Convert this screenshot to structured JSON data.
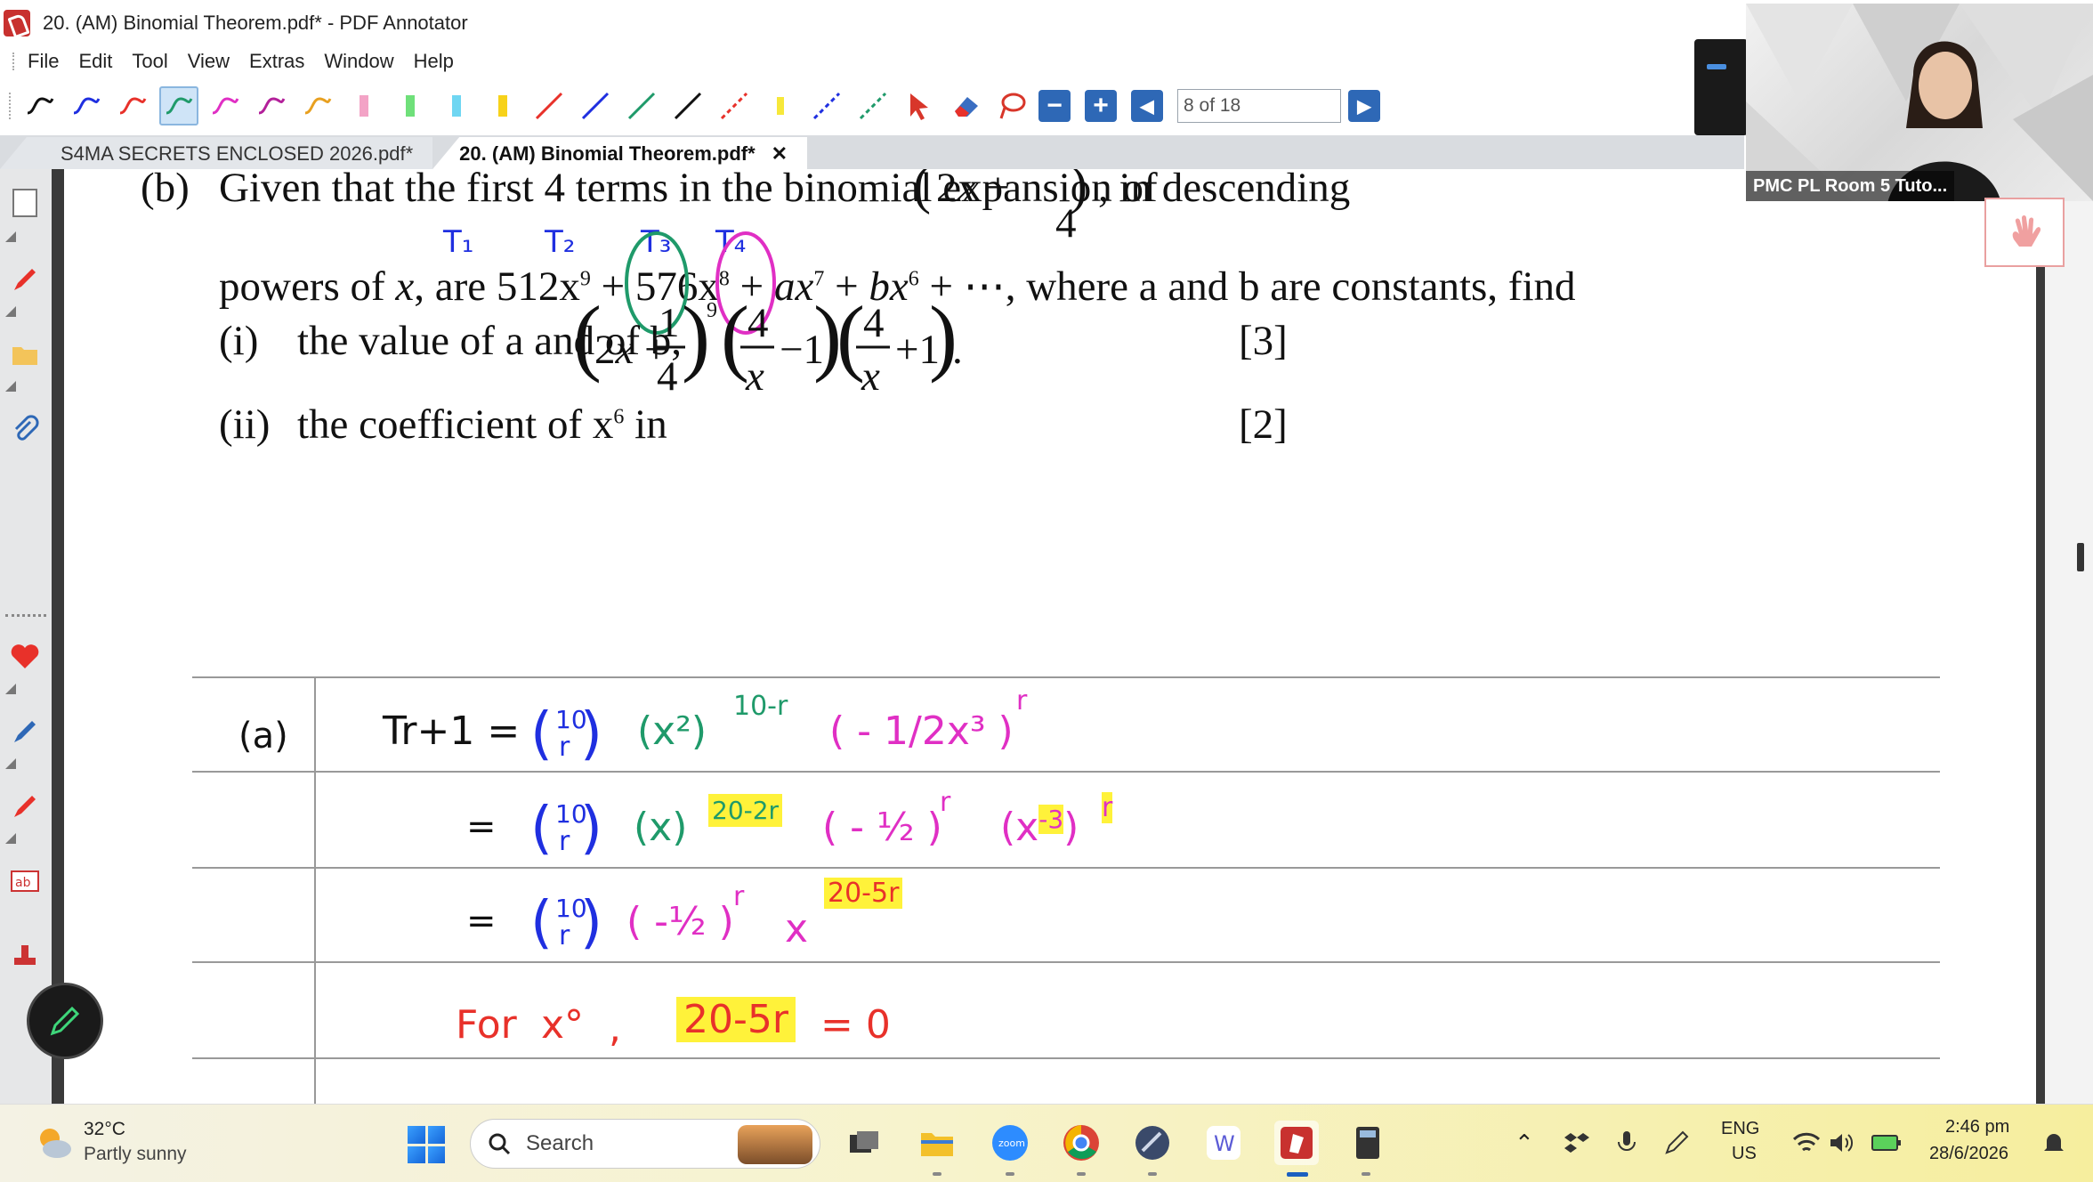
{
  "window": {
    "title": "20. (AM) Binomial Theorem.pdf* - PDF Annotator"
  },
  "menu": {
    "items": [
      "File",
      "Edit",
      "Tool",
      "View",
      "Extras",
      "Window",
      "Help"
    ]
  },
  "toolbar": {
    "page_indicator": "8 of 18"
  },
  "tabs": [
    {
      "label": "S4MA SECRETS ENCLOSED 2026.pdf*"
    },
    {
      "label": "20. (AM) Binomial Theorem.pdf*",
      "close": "✕"
    }
  ],
  "document": {
    "part_b": {
      "label": "(b)",
      "line1": "Given that the first 4 terms in the binomial expansion of",
      "line1_end": ", in descending",
      "line2_lead": "powers of",
      "line2_x": "x",
      "line2_are": ", are",
      "term1": "512x",
      "term1_exp": "9",
      "term2": "576x",
      "term2_exp": "8",
      "term3": "ax",
      "term3_exp": "7",
      "term4": "bx",
      "term4_exp": "6",
      "line2_end": "+ ⋯, where a and b are constants, find",
      "sub_i_label": "(i)",
      "sub_i_text": "the value of a and of b,",
      "sub_i_marks": "[3]",
      "sub_ii_label": "(ii)",
      "sub_ii_text": "the coefficient of x",
      "sub_ii_exp": "6",
      "sub_ii_in": "in",
      "sub_ii_marks": "[2]",
      "annot_t1": "T₁",
      "annot_t2": "T₂",
      "annot_t3": "T₃",
      "annot_t4": "T₄"
    },
    "working": {
      "part_label": "(a)",
      "line1_lhs": "Tr+1 =",
      "binom_top": "10",
      "binom_bottom": "r",
      "line1_t1": "(x²)",
      "line1_t1_exp": "10-r",
      "line1_t2": "( - 1/2x³ )",
      "line1_t2_exp": "r",
      "line2_eq": "=",
      "line2_t1": "(x)",
      "line2_t1_exp": "20-2r",
      "line2_t2": "( - ½ )",
      "line2_t2_exp": "r",
      "line2_t3": "(x",
      "line2_t3_inner": "-3",
      "line2_t3_close": ")",
      "line2_t3_exp": "r",
      "line3_eq": "=",
      "line3_t1": "( -½ )",
      "line3_t1_exp": "r",
      "line3_x": "x",
      "line3_exp": "20-5r",
      "line4_for": "For",
      "line4_x": "x°",
      "line4_comma": ",",
      "line4_expr": "20-5r",
      "line4_eq": "= 0"
    }
  },
  "video": {
    "label": "PMC PL Room 5 Tuto..."
  },
  "taskbar": {
    "weather_temp": "32°C",
    "weather_desc": "Partly sunny",
    "search_label": "Search",
    "lang_top": "ENG",
    "lang_bottom": "US",
    "time": "2:46 pm",
    "date": "28/6/2026"
  },
  "colors": {
    "accent_blue": "#2e68b6",
    "ink_blue": "#1f2fe0",
    "ink_green": "#1f9a6a",
    "ink_magenta": "#e02fc4",
    "ink_red": "#e8312a",
    "highlight": "#fff23a"
  }
}
